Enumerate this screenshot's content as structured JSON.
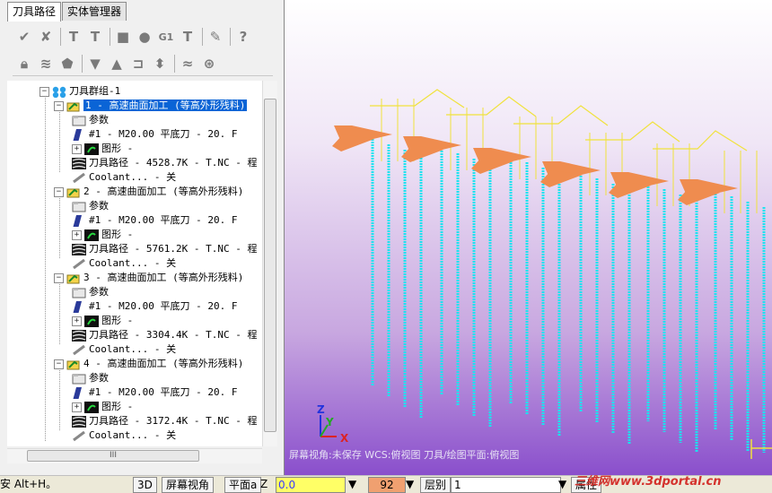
{
  "tabs": [
    "刀具路径",
    "实体管理器"
  ],
  "toolbar1": [
    "check-all-icon",
    "check-icon",
    "toolpath-regen-icon",
    "toolpath-clear-icon",
    "square-icon",
    "shape-icon",
    "G1",
    "post-icon",
    "edit-icon",
    "help-icon"
  ],
  "toolbar2": [
    "lock-icon",
    "wave-icon",
    "lock2-icon",
    "arrow-down-icon",
    "arrow-up-icon",
    "insert-icon",
    "updown-icon",
    "wave2-icon",
    "nav-icon"
  ],
  "tree": {
    "group": "刀具群组-1",
    "operations": [
      {
        "title": "1 - 高速曲面加工 (等高外形残料)",
        "params": "参数",
        "tool": "#1 - M20.00 平底刀 -     20. F",
        "geometry": "图形 -",
        "toolpath": "刀具路径 - 4528.7K - T.NC - 程",
        "coolant": "Coolant... - 关"
      },
      {
        "title": "2 - 高速曲面加工 (等高外形残料)",
        "params": "参数",
        "tool": "#1 - M20.00 平底刀 -     20. F",
        "geometry": "图形 -",
        "toolpath": "刀具路径 - 5761.2K - T.NC - 程",
        "coolant": "Coolant... - 关"
      },
      {
        "title": "3 - 高速曲面加工 (等高外形残料)",
        "params": "参数",
        "tool": "#1 - M20.00 平底刀 -     20. F",
        "geometry": "图形 -",
        "toolpath": "刀具路径 - 3304.4K - T.NC - 程",
        "coolant": "Coolant... - 关"
      },
      {
        "title": "4 - 高速曲面加工 (等高外形残料)",
        "params": "参数",
        "tool": "#1 - M20.00 平底刀 -     20. F",
        "geometry": "图形 -",
        "toolpath": "刀具路径 - 3172.4K - T.NC - 程",
        "coolant": "Coolant... - 关"
      }
    ]
  },
  "hscroll_label": "III",
  "viewport": {
    "status": "屏幕视角:未保存    WCS:俯视图    刀具/绘图平面:俯视图",
    "axis_z": "Z",
    "axis_y": "Y",
    "axis_x": "X",
    "watermark": "三维网www.3dportal.cn",
    "colors": {
      "toolpath": "#19e3f0",
      "clamp": "#f0e23c",
      "fixture": "#ef8c4f"
    }
  },
  "statusbar": {
    "hint": "安 Alt+H。",
    "btn_3d": "3D",
    "btn_view": "屏幕视角",
    "btn_plane": "平面a",
    "z_label": "Z",
    "z_value": "0.0",
    "color_value": "92",
    "level_label": "层别",
    "level_value": "1",
    "attr_label": "属性"
  }
}
